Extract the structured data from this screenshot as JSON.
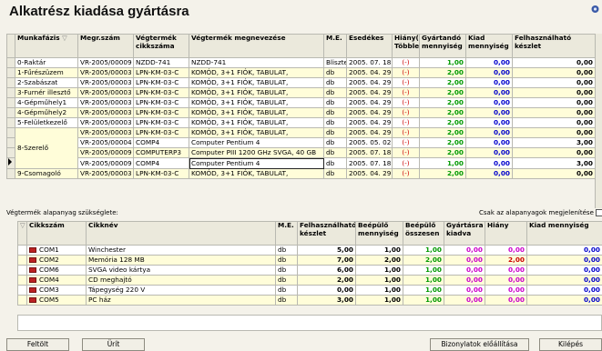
{
  "title": "Alkatrész kiadása gyártásra",
  "top": {
    "cols": [
      "Munkafázis",
      "Megr.szám",
      "Végtermék cikkszáma",
      "Végtermék megnevezése",
      "M.E.",
      "Esedékes",
      "Hiány(-) Többlet",
      "Gyártandó mennyiség",
      "Kiad mennyiség",
      "Felhasználható készlet"
    ],
    "rows": [
      {
        "f": "0-Raktár",
        "m": "VR-2005/00009",
        "c": "NZDD-741",
        "n": "NZDD-741",
        "e": "Bliszte",
        "d": "2005. 07. 18.",
        "h": "(-)",
        "g": "1,00",
        "k": "0,00",
        "fk": "0,00"
      },
      {
        "f": "1-Fűrészüzem",
        "m": "VR-2005/00003",
        "c": "LPN-KM-03-C",
        "n": "KOMÓD, 3+1 FIÓK, TABULAT,",
        "e": "db",
        "d": "2005. 04. 29.",
        "h": "(-)",
        "g": "2,00",
        "k": "0,00",
        "fk": "0,00"
      },
      {
        "f": "2-Szabászat",
        "m": "VR-2005/00003",
        "c": "LPN-KM-03-C",
        "n": "KOMÓD, 3+1 FIÓK, TABULAT,",
        "e": "db",
        "d": "2005. 04. 29.",
        "h": "(-)",
        "g": "2,00",
        "k": "0,00",
        "fk": "0,00"
      },
      {
        "f": "3-Furnér illesztő",
        "m": "VR-2005/00003",
        "c": "LPN-KM-03-C",
        "n": "KOMÓD, 3+1 FIÓK, TABULAT,",
        "e": "db",
        "d": "2005. 04. 29.",
        "h": "(-)",
        "g": "2,00",
        "k": "0,00",
        "fk": "0,00"
      },
      {
        "f": "4-Gépműhely1",
        "m": "VR-2005/00003",
        "c": "LPN-KM-03-C",
        "n": "KOMÓD, 3+1 FIÓK, TABULAT,",
        "e": "db",
        "d": "2005. 04. 29.",
        "h": "(-)",
        "g": "2,00",
        "k": "0,00",
        "fk": "0,00"
      },
      {
        "f": "4-Gépműhely2",
        "m": "VR-2005/00003",
        "c": "LPN-KM-03-C",
        "n": "KOMÓD, 3+1 FIÓK, TABULAT,",
        "e": "db",
        "d": "2005. 04. 29.",
        "h": "(-)",
        "g": "2,00",
        "k": "0,00",
        "fk": "0,00"
      },
      {
        "f": "5-Felületkezelő",
        "m": "VR-2005/00003",
        "c": "LPN-KM-03-C",
        "n": "KOMÓD, 3+1 FIÓK, TABULAT,",
        "e": "db",
        "d": "2005. 04. 29.",
        "h": "(-)",
        "g": "2,00",
        "k": "0,00",
        "fk": "0,00"
      },
      {
        "f": "",
        "m": "VR-2005/00003",
        "c": "LPN-KM-03-C",
        "n": "KOMÓD, 3+1 FIÓK, TABULAT,",
        "e": "db",
        "d": "2005. 04. 29.",
        "h": "(-)",
        "g": "2,00",
        "k": "0,00",
        "fk": "0,00"
      },
      {
        "f": "",
        "m": "VR-2005/00004",
        "c": "COMP4",
        "n": "Computer Pentium 4",
        "e": "db",
        "d": "2005. 05. 02.",
        "h": "(-)",
        "g": "2,00",
        "k": "0,00",
        "fk": "3,00"
      },
      {
        "f": "",
        "m": "VR-2005/00009",
        "c": "COMPUTERP3",
        "n": "Computer PIII 1200 GHz SVGA, 40 GB",
        "e": "db",
        "d": "2005. 07. 18.",
        "h": "(-)",
        "g": "2,00",
        "k": "0,00",
        "fk": "0,00"
      },
      {
        "f": "",
        "m": "VR-2005/00009",
        "c": "COMP4",
        "n": "Computer Pentium 4",
        "e": "db",
        "d": "2005. 07. 18.",
        "h": "(-)",
        "g": "1,00",
        "k": "0,00",
        "fk": "3,00"
      },
      {
        "f": "9-Csomagoló",
        "m": "VR-2005/00003",
        "c": "LPN-KM-03-C",
        "n": "KOMÓD, 3+1 FIÓK, TABULAT,",
        "e": "db",
        "d": "2005. 04. 29.",
        "h": "(-)",
        "g": "2,00",
        "k": "0,00",
        "fk": "0,00"
      }
    ],
    "merged_label": "8-Szerelő"
  },
  "mid": {
    "left": "Végtermék alapanyag szükséglete:",
    "right": "Csak az alapanyagok megjelenítése"
  },
  "bottom": {
    "cols": [
      "Cikkszám",
      "Cikknév",
      "M.E.",
      "Felhasználható készlet",
      "Beépülő mennyiség",
      "Beépülő összesen",
      "Gyártásra kiadva",
      "Hiány",
      "Kiad mennyiség"
    ],
    "rows": [
      {
        "c": "COM1",
        "n": "Winchester",
        "e": "db",
        "fk": "5,00",
        "bm": "1,00",
        "bo": "1,00",
        "gk": "0,00",
        "h": "0,00",
        "k": "0,00"
      },
      {
        "c": "COM2",
        "n": "Memória 128 MB",
        "e": "db",
        "fk": "7,00",
        "bm": "2,00",
        "bo": "2,00",
        "gk": "0,00",
        "h": "2,00",
        "k": "0,00"
      },
      {
        "c": "COM6",
        "n": "SVGA video kártya",
        "e": "db",
        "fk": "6,00",
        "bm": "1,00",
        "bo": "1,00",
        "gk": "0,00",
        "h": "0,00",
        "k": "0,00"
      },
      {
        "c": "COM4",
        "n": "CD meghajtó",
        "e": "db",
        "fk": "2,00",
        "bm": "1,00",
        "bo": "1,00",
        "gk": "0,00",
        "h": "0,00",
        "k": "0,00"
      },
      {
        "c": "COM3",
        "n": "Tápegység 220 V",
        "e": "db",
        "fk": "0,00",
        "bm": "1,00",
        "bo": "1,00",
        "gk": "0,00",
        "h": "0,00",
        "k": "0,00"
      },
      {
        "c": "COM5",
        "n": "PC ház",
        "e": "db",
        "fk": "3,00",
        "bm": "1,00",
        "bo": "1,00",
        "gk": "0,00",
        "h": "0,00",
        "k": "0,00"
      }
    ]
  },
  "buttons": {
    "feltolt": "Feltölt",
    "urit": "Ürít",
    "print": "Bizonylatok előállítása",
    "exit": "Kilépés"
  }
}
